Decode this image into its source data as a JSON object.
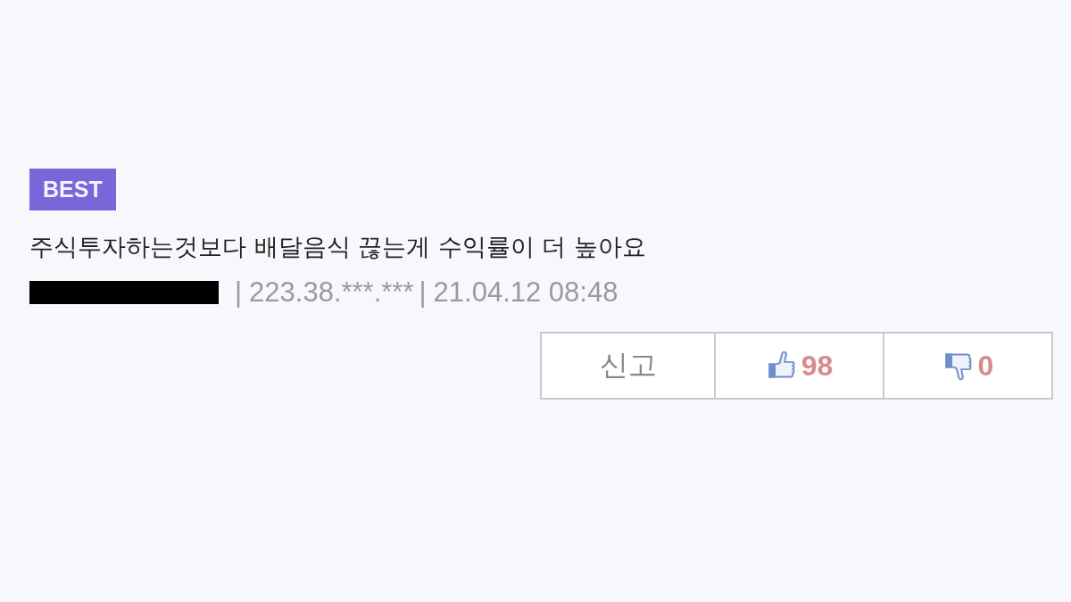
{
  "comment": {
    "badge": "BEST",
    "text": "주식투자하는것보다 배달음식 끊는게 수익률이 더 높아요",
    "separator_1": "|",
    "ip": "223.38.***.***",
    "separator_2": "|",
    "date": "21.04.12 08:48"
  },
  "actions": [
    {
      "kind": "report",
      "label": "신고"
    },
    {
      "kind": "like",
      "count": "98"
    },
    {
      "kind": "dislike",
      "count": "0"
    }
  ]
}
